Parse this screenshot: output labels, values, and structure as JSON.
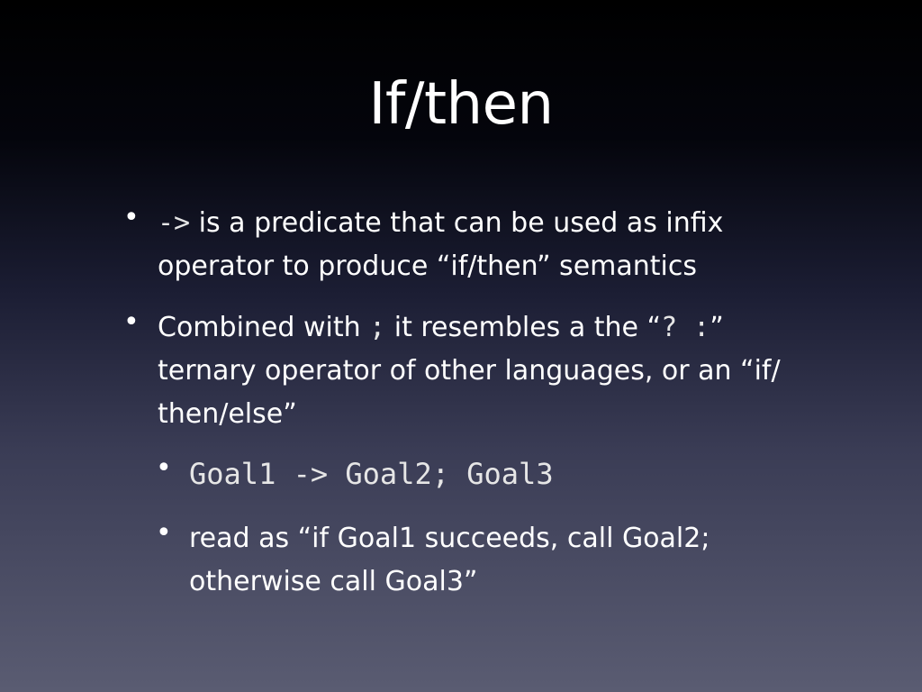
{
  "slide": {
    "title": "If/then",
    "bullet1": {
      "code": "->",
      "text_line1": " is a predicate that can be used as infix",
      "text_line2": "operator to produce “if/then” semantics"
    },
    "bullet2": {
      "text_a": "Combined with ",
      "code_semicolon": ";",
      "text_b": " it resembles a the “",
      "code_ternary": "? :",
      "text_c": "”",
      "text_line2": "ternary operator of other languages, or an “if/",
      "text_line3": "then/else”"
    },
    "sub_bullet1": {
      "code": "Goal1 -> Goal2; Goal3"
    },
    "sub_bullet2": {
      "text_line1": "read as “if Goal1 succeeds, call Goal2;",
      "text_line2": "otherwise call Goal3”"
    }
  },
  "colors": {
    "background_top": "#000000",
    "background_bottom": "#5a5c72",
    "text": "#ffffff"
  }
}
